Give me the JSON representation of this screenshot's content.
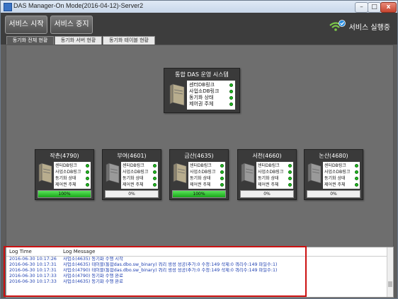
{
  "window": {
    "title": "DAS Manager-On Mode(2016-04-12)-Server2"
  },
  "toolbar": {
    "start_label": "서비스 시작",
    "stop_label": "서비스 중지",
    "status_label": "서비스 실행중"
  },
  "tabs": [
    {
      "label": "동기화 전체 현황"
    },
    {
      "label": "동기화 서버 현황"
    },
    {
      "label": "동기화 테이블 현황"
    }
  ],
  "main_card": {
    "title": "통합 DAS 운영 시스템",
    "items": [
      "센터DB링크",
      "사업소DB링크",
      "동기화 상태",
      "제어권 주체"
    ]
  },
  "servers": [
    {
      "name": "작촌(4790)",
      "items": [
        "센터DB링크",
        "사업소DB링크",
        "동기화 상태",
        "제어권 주체"
      ],
      "progress": 100,
      "progress_label": "100%",
      "active": true
    },
    {
      "name": "부여(4601)",
      "items": [
        "센터DB링크",
        "사업소DB링크",
        "동기화 상태",
        "제어권 주체"
      ],
      "progress": 0,
      "progress_label": "0%",
      "active": false
    },
    {
      "name": "금산(4635)",
      "items": [
        "센터DB링크",
        "사업소DB링크",
        "동기화 상태",
        "제어권 주체"
      ],
      "progress": 100,
      "progress_label": "100%",
      "active": true
    },
    {
      "name": "서천(4660)",
      "items": [
        "센터DB링크",
        "사업소DB링크",
        "동기화 상태",
        "제어권 주체"
      ],
      "progress": 0,
      "progress_label": "0%",
      "active": false
    },
    {
      "name": "논산(4680)",
      "items": [
        "센터DB링크",
        "사업소DB링크",
        "동기화 상태",
        "제어권 주체"
      ],
      "progress": 0,
      "progress_label": "0%",
      "active": false
    }
  ],
  "log": {
    "col_time": "Log Time",
    "col_message": "Log Message",
    "rows": [
      {
        "time": "2016-06-30 10:17:26",
        "message": "사업소(4635) 동기화 수행 시작"
      },
      {
        "time": "2016-06-30 10:17:31",
        "message": "사업소(4635) 테이블(통합das.dbo.sw_binary) 쿼리 생성 성공(추가:0 수정:149 삭제:0 쿼리수:149 파일수:1)"
      },
      {
        "time": "2016-06-30 10:17:31",
        "message": "사업소(4790) 테이블(통합das.dbo.sw_binary) 쿼리 생성 성공(추가:0 수정:149 삭제:0 쿼리수:149 파일수:1)"
      },
      {
        "time": "2016-06-30 10:17:33",
        "message": "사업소(4790) 동기화 수행 완료"
      },
      {
        "time": "2016-06-30 10:17:33",
        "message": "사업소(4635) 동기화 수행 완료"
      }
    ]
  },
  "colors": {
    "status_ok": "#22bb22",
    "progress_fill": "#18a818",
    "log_text": "#1e3fb0",
    "highlight": "#cc1111"
  }
}
